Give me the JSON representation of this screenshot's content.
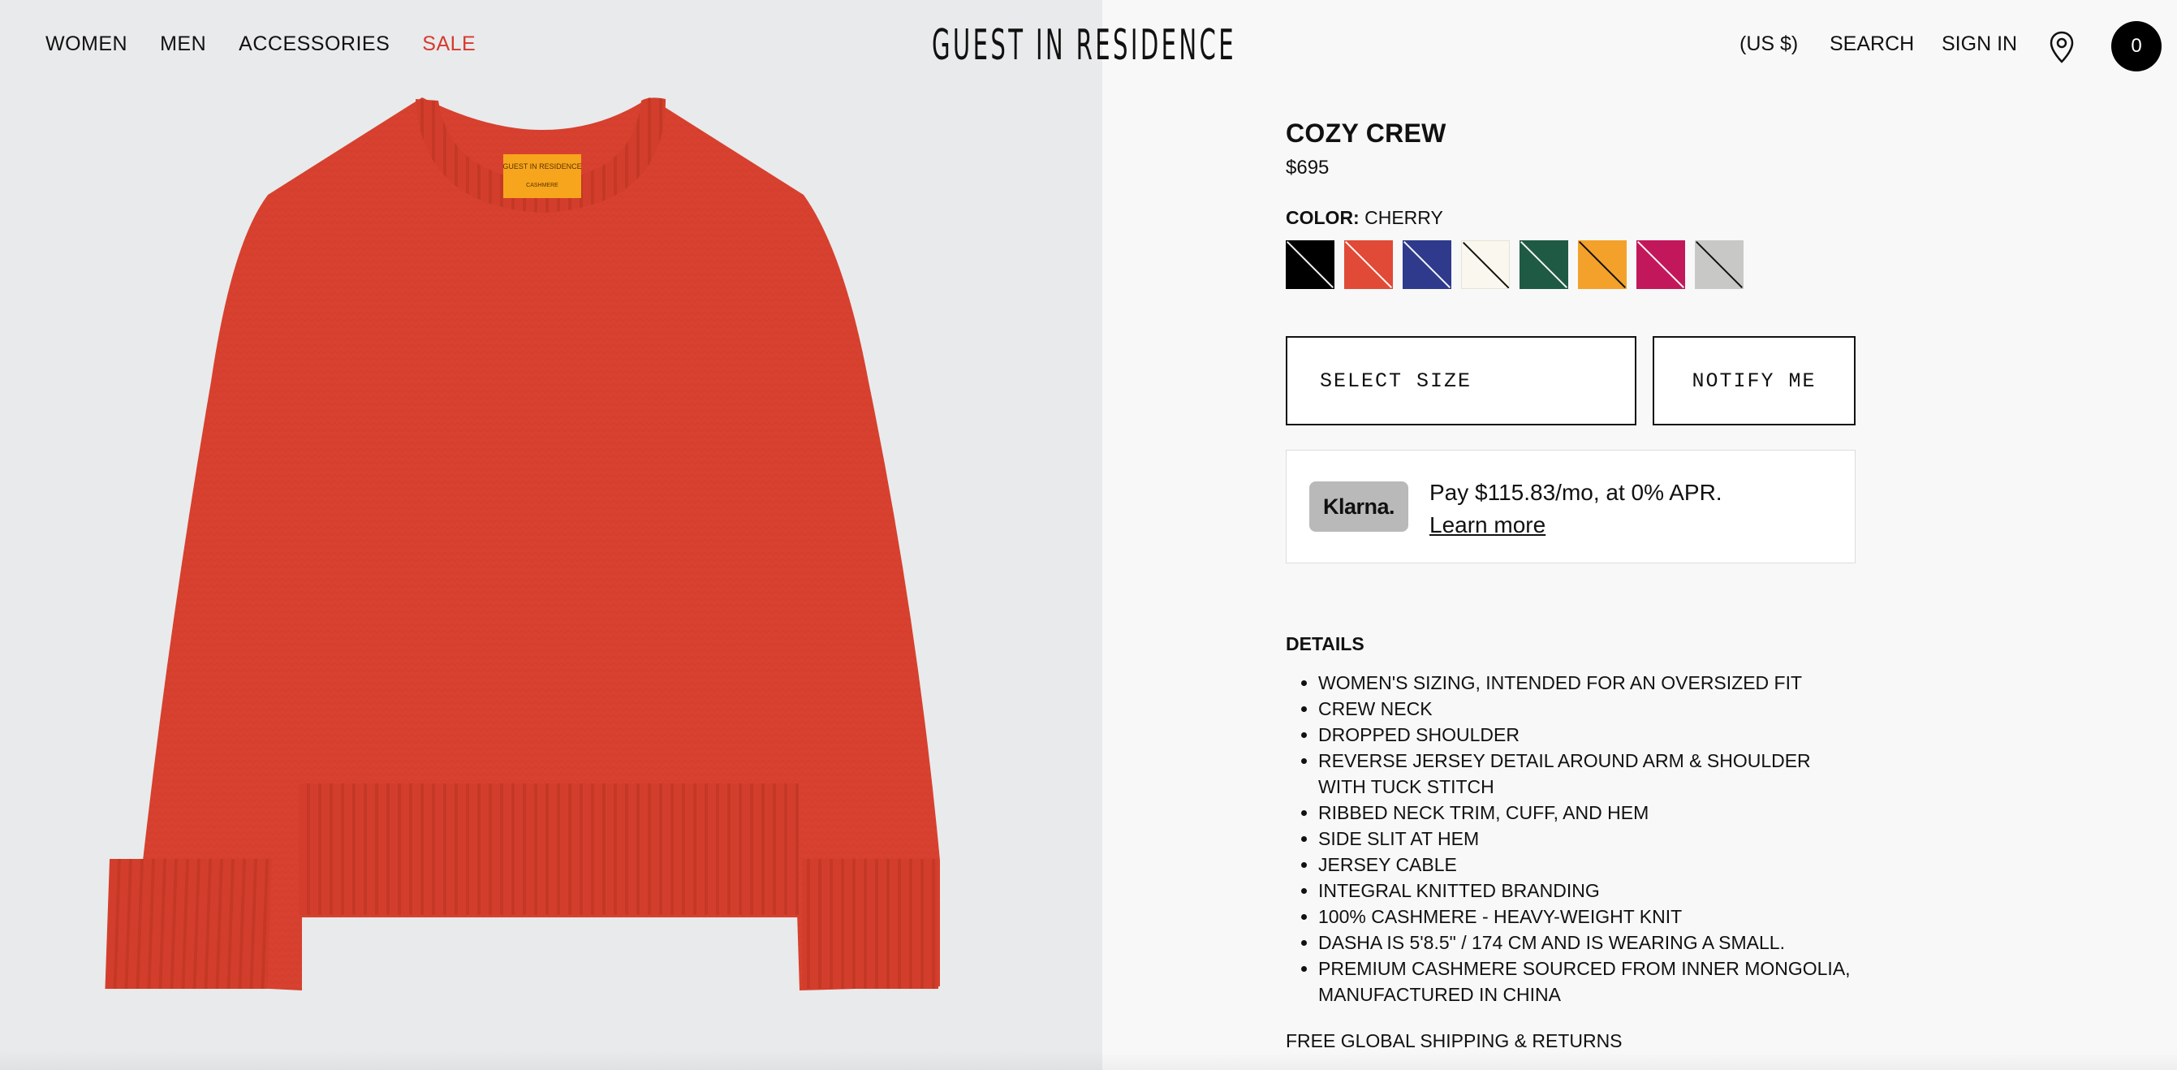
{
  "header": {
    "nav": [
      {
        "label": "WOMEN"
      },
      {
        "label": "MEN"
      },
      {
        "label": "ACCESSORIES"
      },
      {
        "label": "SALE"
      }
    ],
    "logo": "GUEST IN RESIDENCE",
    "currency": "(US $)",
    "search": "SEARCH",
    "sign_in": "SIGN IN",
    "cart_count": "0"
  },
  "product": {
    "title": "COZY CREW",
    "price": "$695",
    "color_label": "COLOR:",
    "color_value": "CHERRY",
    "swatches": [
      {
        "color": "#000000",
        "tone": "dark"
      },
      {
        "color": "#e04a36",
        "tone": "dark"
      },
      {
        "color": "#2f3a8c",
        "tone": "dark"
      },
      {
        "color": "#faf8ee",
        "tone": "light"
      },
      {
        "color": "#1f5a44",
        "tone": "dark"
      },
      {
        "color": "#f3a12a",
        "tone": "light"
      },
      {
        "color": "#c2185b",
        "tone": "dark"
      },
      {
        "color": "#c8c9c7",
        "tone": "light"
      }
    ],
    "select_size": "SELECT SIZE",
    "notify_me": "NOTIFY ME",
    "klarna": {
      "logo": "Klarna.",
      "text": "Pay $115.83/mo, at 0% APR.",
      "link": "Learn more"
    },
    "details_heading": "DETAILS",
    "details": [
      "WOMEN'S SIZING, INTENDED FOR AN OVERSIZED FIT",
      "CREW NECK",
      "DROPPED SHOULDER",
      "REVERSE JERSEY DETAIL AROUND ARM & SHOULDER WITH TUCK STITCH",
      "RIBBED NECK TRIM, CUFF, AND HEM",
      "SIDE SLIT AT HEM",
      "JERSEY CABLE",
      "INTEGRAL KNITTED BRANDING",
      "100% CASHMERE - HEAVY-WEIGHT KNIT",
      "DASHA IS 5'8.5\" / 174 CM AND IS WEARING A SMALL.",
      "PREMIUM CASHMERE SOURCED FROM INNER MONGOLIA, MANUFACTURED IN CHINA"
    ],
    "shipping": "FREE GLOBAL SHIPPING & RETURNS",
    "image_label": {
      "brand": "GUEST IN RESIDENCE",
      "sub": "CASHMERE"
    }
  },
  "colors": {
    "sweater": "#d8412f",
    "label": "#f7a51c",
    "sale": "#d63a2f"
  }
}
